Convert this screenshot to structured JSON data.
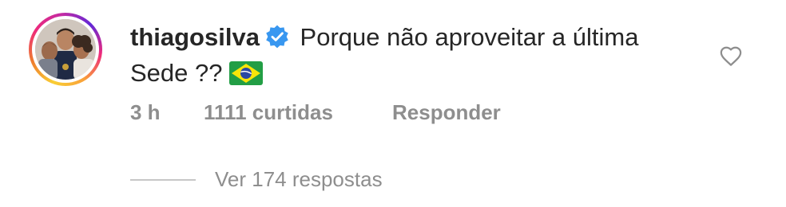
{
  "comment": {
    "username": "thiagosilva",
    "verified": true,
    "text": "Porque não aproveitar a última Sede ??",
    "flag_emoji": "brazil-flag"
  },
  "meta": {
    "time": "3 h",
    "likes": "1111 curtidas",
    "reply": "Responder"
  },
  "replies": {
    "label": "Ver 174 respostas"
  },
  "colors": {
    "verified_blue": "#3897f0",
    "meta_gray": "#8e8e8e",
    "text": "#262626"
  }
}
